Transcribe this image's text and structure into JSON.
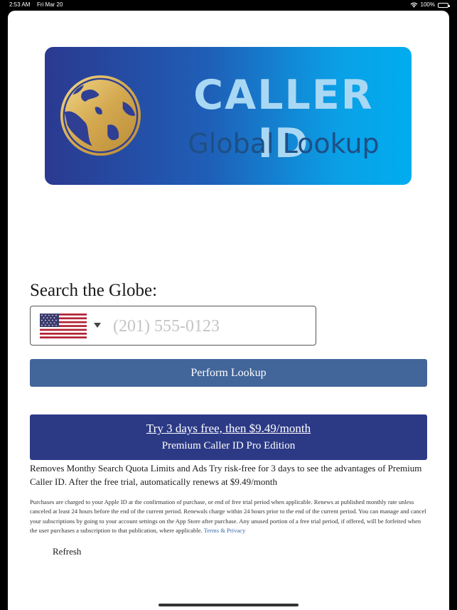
{
  "status_bar": {
    "time": "2:53 AM",
    "date": "Fri Mar 20",
    "battery": "100%"
  },
  "banner": {
    "title": "CALLER ID",
    "subtitle": "Global Lookup",
    "colors": {
      "start": "#2b3990",
      "end": "#00adef",
      "title": "#a9d8f5",
      "subtitle": "#1e4f86",
      "globe": "#d9b45a"
    }
  },
  "search": {
    "label": "Search the Globe:",
    "country_icon": "us-flag-icon",
    "phone_placeholder": "(201) 555-0123",
    "phone_value": ""
  },
  "lookup": {
    "button_label": "Perform Lookup",
    "color": "#42659a"
  },
  "promo": {
    "offer": "Try 3 days free, then $9.49/month",
    "edition": "Premium Caller ID Pro Edition",
    "color": "#2c3a86"
  },
  "description": "Removes Monthy Search Quota Limits and Ads Try risk-free for 3 days to see the advantages of Premium Caller ID. After the free trial, automatically renews at $9.49/month",
  "legal": {
    "text": "Purchases are charged to your Apple ID at the confirmation of purchase, or end of free trial period when applicable. Renews at published monthly rate unless canceled at least 24 hours before the end of the current period. Renewals charge within 24 hours prior to the end of the current period. You can manage and cancel your subscriptions by going to your account settings on the App Store after purchase. Any unused portion of a free trial period, if offered, will be forfeited when the user purchases a subscription to that publication, where applicable.",
    "link_label": "Terms & Privacy"
  },
  "refresh_label": "Refresh"
}
